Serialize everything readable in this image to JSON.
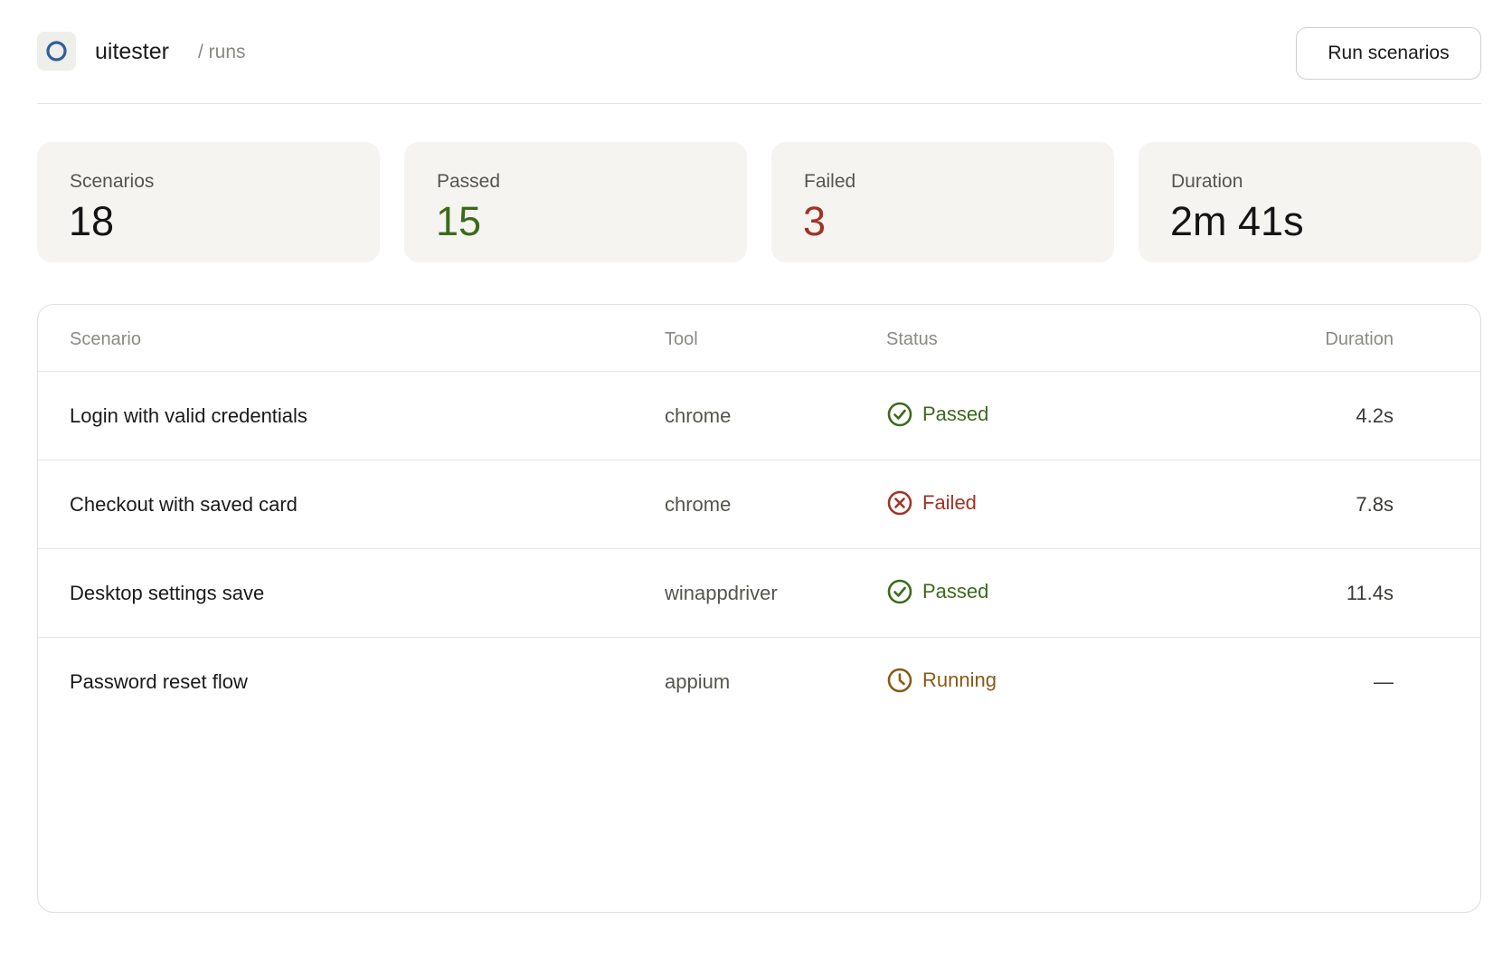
{
  "header": {
    "app_name": "uitester",
    "breadcrumb": "/ runs",
    "run_button_label": "Run scenarios"
  },
  "stats": [
    {
      "label": "Scenarios",
      "value": "18"
    },
    {
      "label": "Passed",
      "value": "15",
      "color": "#3b6b1a"
    },
    {
      "label": "Failed",
      "value": "3",
      "color": "#a03325"
    },
    {
      "label": "Duration",
      "value": "2m 41s"
    }
  ],
  "table": {
    "columns": [
      "Scenario",
      "Tool",
      "Status",
      "Duration"
    ],
    "rows": [
      {
        "scenario": "Login with valid credentials",
        "tool": "chrome",
        "status": "Passed",
        "status_icon": "check-circle-icon",
        "duration": "4.2s"
      },
      {
        "scenario": "Checkout with saved card",
        "tool": "chrome",
        "status": "Failed",
        "status_icon": "x-circle-icon",
        "duration": "7.8s"
      },
      {
        "scenario": "Desktop settings save",
        "tool": "winappdriver",
        "status": "Passed",
        "status_icon": "check-circle-icon",
        "duration": "11.4s"
      },
      {
        "scenario": "Password reset flow",
        "tool": "appium",
        "status": "Running",
        "status_icon": "clock-icon",
        "duration": "—"
      }
    ]
  },
  "colors": {
    "passed": "#3b6b1a",
    "failed": "#a03325",
    "running": "#8a5a14",
    "logo_ring": "#2f5f9e"
  }
}
